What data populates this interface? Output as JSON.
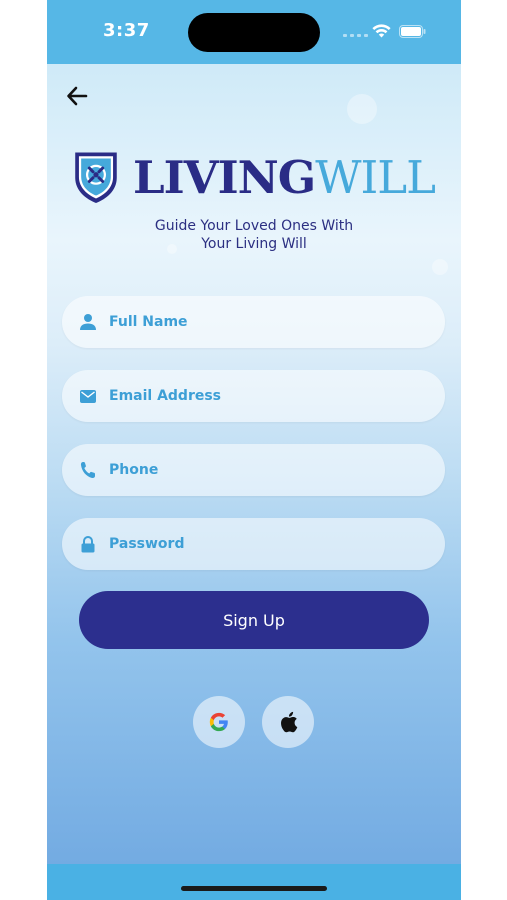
{
  "status_bar": {
    "time": "3:37"
  },
  "icons": {
    "back": "arrow-left-icon",
    "logo": "shield-logo-icon",
    "full_name": "person-icon",
    "email": "mail-icon",
    "phone": "phone-icon",
    "password": "lock-icon",
    "google": "google-icon",
    "apple": "apple-icon"
  },
  "brand": {
    "part1": "LIVING",
    "part2": "WILL",
    "tagline_line1": "Guide Your Loved Ones With",
    "tagline_line2": "Your Living Will"
  },
  "form": {
    "full_name": {
      "placeholder": "Full Name",
      "value": ""
    },
    "email": {
      "placeholder": "Email Address",
      "value": ""
    },
    "phone": {
      "placeholder": "Phone",
      "value": ""
    },
    "password": {
      "placeholder": "Password",
      "value": ""
    },
    "submit_label": "Sign Up"
  },
  "colors": {
    "primary": "#2c2f8e",
    "accent": "#46a9db",
    "status_bar": "#56b7e6"
  }
}
